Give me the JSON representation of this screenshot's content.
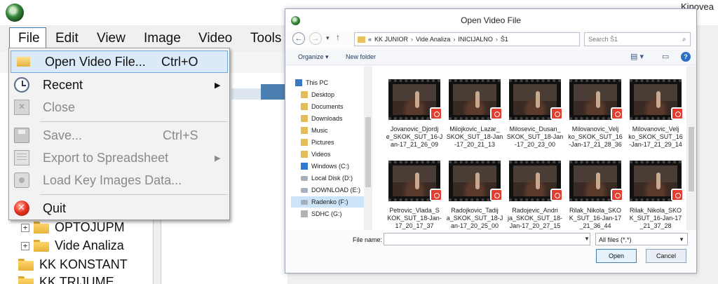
{
  "kinovea": {
    "app_name": "Kinovea",
    "menubar": [
      "File",
      "Edit",
      "View",
      "Image",
      "Video",
      "Tools"
    ],
    "tree": [
      {
        "label": "OPTOJUPM",
        "expander": "+"
      },
      {
        "label": "Vide Analiza",
        "expander": "+"
      },
      {
        "label": "KK KONSTANT",
        "expander": ""
      },
      {
        "label": "KK TRIJUME",
        "expander": ""
      }
    ]
  },
  "file_menu": {
    "items": [
      {
        "label": "Open Video File...",
        "shortcut": "Ctrl+O",
        "icon": "folder-open-icon",
        "enabled": true,
        "highlighted": true
      },
      {
        "label": "Recent",
        "shortcut": "",
        "icon": "clock-icon",
        "enabled": true,
        "submenu": true
      },
      {
        "label": "Close",
        "shortcut": "",
        "icon": "close-document-icon",
        "enabled": false
      },
      {
        "label": "Save...",
        "shortcut": "Ctrl+S",
        "icon": "floppy-disk-icon",
        "enabled": false
      },
      {
        "label": "Export to Spreadsheet",
        "shortcut": "",
        "icon": "spreadsheet-icon",
        "enabled": false,
        "submenu": true
      },
      {
        "label": "Load Key Images Data...",
        "shortcut": "",
        "icon": "key-images-icon",
        "enabled": false
      },
      {
        "label": "Quit",
        "shortcut": "",
        "icon": "quit-icon",
        "enabled": true
      }
    ],
    "submenu_arrow": "▶"
  },
  "dialog": {
    "title": "Open Video File",
    "nav": {
      "back": "←",
      "forward": "→",
      "up": "↑",
      "dropdown": "▾"
    },
    "breadcrumb": [
      "«",
      "KK JUNIOR",
      "Vide Analiza",
      "INICIJALNO",
      "Š1"
    ],
    "breadcrumb_sep": "›",
    "search_placeholder": "Search Š1",
    "toolbar": {
      "organize": "Organize ▾",
      "new_folder": "New folder",
      "view": "▤ ▾",
      "help": "?"
    },
    "nav_pane": [
      {
        "label": "This PC",
        "icon": "computer-icon"
      },
      {
        "label": "Desktop",
        "icon": "folder-icon"
      },
      {
        "label": "Documents",
        "icon": "folder-icon"
      },
      {
        "label": "Downloads",
        "icon": "folder-icon"
      },
      {
        "label": "Music",
        "icon": "folder-icon"
      },
      {
        "label": "Pictures",
        "icon": "folder-icon"
      },
      {
        "label": "Videos",
        "icon": "folder-icon"
      },
      {
        "label": "Windows (C:)",
        "icon": "windows-drive-icon"
      },
      {
        "label": "Local Disk (D:)",
        "icon": "drive-icon"
      },
      {
        "label": "DOWNLOAD (E:)",
        "icon": "drive-icon"
      },
      {
        "label": "Radenko (F:)",
        "icon": "drive-icon",
        "selected": true
      },
      {
        "label": "SDHC (G:)",
        "icon": "sd-card-icon"
      }
    ],
    "files": [
      {
        "line1": "Jovanovic_Djordj",
        "line2": "e_SKOK_SUT_16-J",
        "line3": "an-17_21_26_09"
      },
      {
        "line1": "Milojkovic_Lazar_",
        "line2": "SKOK_SUT_18-Jan",
        "line3": "-17_20_21_13"
      },
      {
        "line1": "Milosevic_Dusan_",
        "line2": "SKOK_SUT_18-Jan",
        "line3": "-17_20_23_00"
      },
      {
        "line1": "Milovanovic_Velj",
        "line2": "ko_SKOK_SUT_16",
        "line3": "-Jan-17_21_28_36"
      },
      {
        "line1": "Milovanovic_Velj",
        "line2": "ko_SKOK_SUT_16",
        "line3": "-Jan-17_21_29_14"
      },
      {
        "line1": "Petrovic_Vlada_S",
        "line2": "KOK_SUT_18-Jan-",
        "line3": "17_20_17_37"
      },
      {
        "line1": "Radojkovic_Tadij",
        "line2": "a_SKOK_SUT_18-J",
        "line3": "an-17_20_25_00"
      },
      {
        "line1": "Radojevic_Andri",
        "line2": "ja_SKOK_SUT_18-",
        "line3": "Jan-17_20_27_15"
      },
      {
        "line1": "Rilak_Nikola_SKO",
        "line2": "K_SUT_16-Jan-17",
        "line3": "_21_36_44"
      },
      {
        "line1": "Rilak_Nikola_SKO",
        "line2": "K_SUT_16-Jan-17",
        "line3": "_21_37_28"
      }
    ],
    "file_name_label": "File name:",
    "file_name_value": "",
    "filter": "All files (*.*)",
    "open_label": "Open",
    "cancel_label": "Cancel"
  }
}
